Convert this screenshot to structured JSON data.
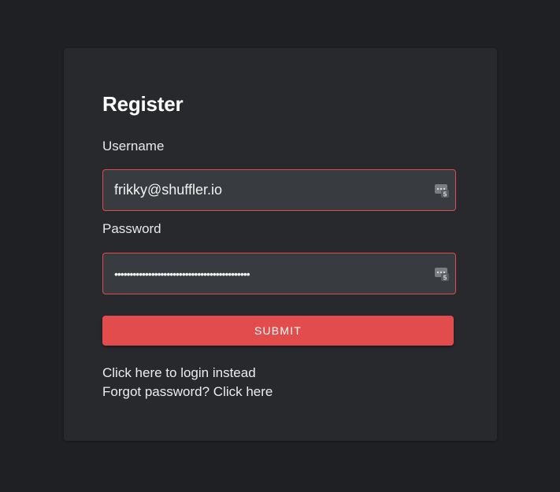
{
  "form": {
    "title": "Register",
    "username_label": "Username",
    "username_value": "frikky@shuffler.io",
    "password_label": "Password",
    "password_value": "••••••••••••••••••••••••••••••••••••••••••••",
    "submit_label": "SUBMIT",
    "login_link": "Click here to login instead",
    "forgot_link": "Forgot password? Click here"
  },
  "icons": {
    "password_manager": "password-manager-icon"
  },
  "colors": {
    "background": "#1f2023",
    "card": "#27292d",
    "input": "#383b40",
    "accent": "#e34c4c"
  }
}
